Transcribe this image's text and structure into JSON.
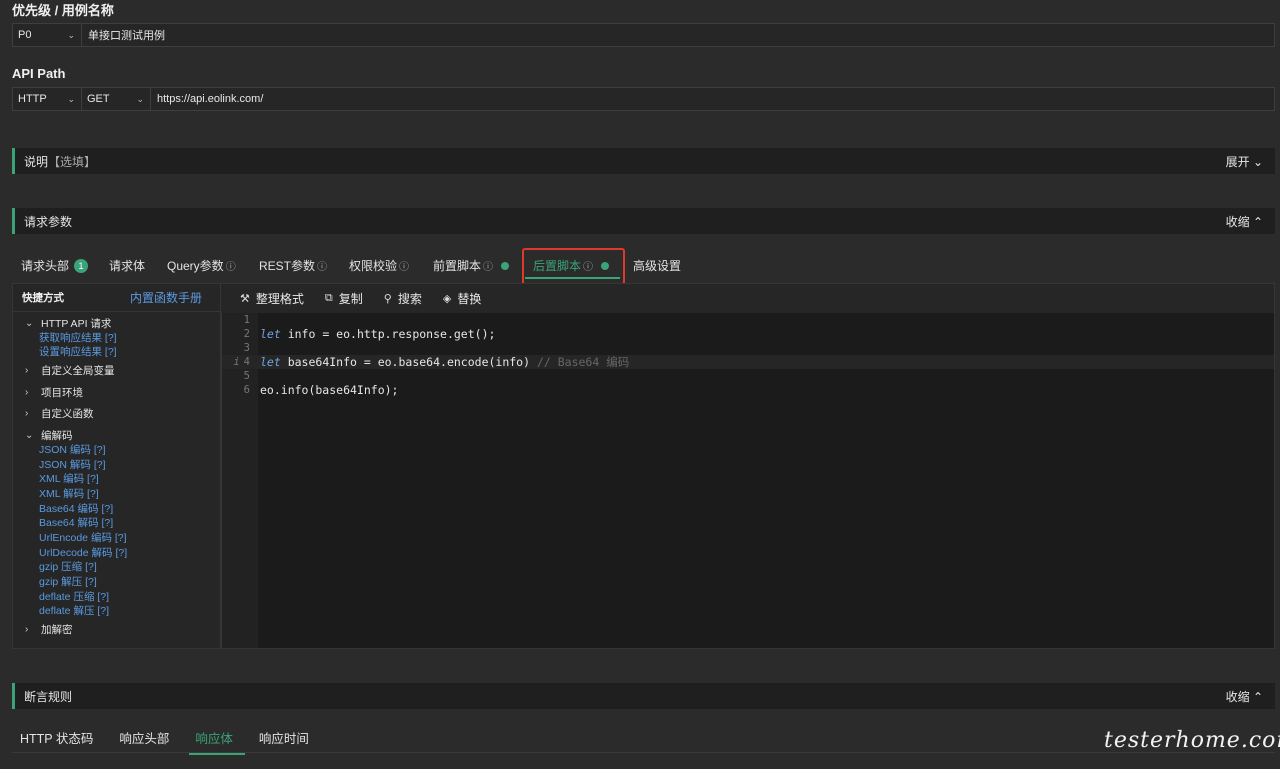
{
  "priority_section": {
    "title": "优先级 / 用例名称",
    "priority": "P0",
    "case_name": "单接口测试用例"
  },
  "api_path_section": {
    "title": "API Path",
    "protocol": "HTTP",
    "method": "GET",
    "url": "https://api.eolink.com/"
  },
  "description_section": {
    "title": "说明",
    "hint": "【选填】",
    "toggle": "展开 ⌄"
  },
  "request_params_section": {
    "title": "请求参数",
    "toggle": "收缩 ⌃"
  },
  "request_tabs": [
    {
      "label": "请求头部",
      "badge": "1"
    },
    {
      "label": "请求体"
    },
    {
      "label": "Query参数",
      "info": "ⓘ"
    },
    {
      "label": "REST参数",
      "info": "ⓘ"
    },
    {
      "label": "权限校验",
      "info": "ⓘ"
    },
    {
      "label": "前置脚本",
      "info": "ⓘ"
    },
    {
      "label": "后置脚本",
      "info": "ⓘ",
      "active": true
    },
    {
      "label": "高级设置"
    }
  ],
  "sidebar": {
    "title": "快捷方式",
    "manual_link": "内置函数手册",
    "groups": {
      "http": "HTTP API 请求",
      "http_items": [
        "获取响应结果 [?]",
        "设置响应结果 [?]"
      ],
      "global_vars": "自定义全局变量",
      "env": "项目环境",
      "funcs": "自定义函数",
      "codec": "编解码",
      "codec_items": [
        "JSON 编码 [?]",
        "JSON 解码 [?]",
        "XML 编码 [?]",
        "XML 解码 [?]",
        "Base64 编码 [?]",
        "Base64 解码 [?]",
        "UrlEncode 编码 [?]",
        "UrlDecode 解码 [?]",
        "gzip 压缩 [?]",
        "gzip 解压 [?]",
        "deflate 压缩 [?]",
        "deflate 解压 [?]"
      ],
      "crypto": "加解密"
    }
  },
  "editor_toolbar": {
    "format": "整理格式",
    "copy": "复制",
    "search": "搜索",
    "replace": "替换"
  },
  "code_lines": {
    "n1": "1",
    "n2": "2",
    "n3": "3",
    "n4": "4",
    "n5": "5",
    "n6": "6",
    "l2_kw": "let",
    "l2_rest": " info = eo.http.response.get();",
    "l4_marker": "i",
    "l4_kw": "let",
    "l4_rest": " base64Info = eo.base64.encode(info) ",
    "l4_comment": "// Base64 编码",
    "l6": "eo.info(base64Info);"
  },
  "assert_section": {
    "title": "断言规则",
    "toggle": "收缩 ⌃"
  },
  "assert_tabs": [
    "HTTP 状态码",
    "响应头部",
    "响应体",
    "响应时间"
  ],
  "watermark": "testerhome.com",
  "colors": {
    "accent": "#3aa377",
    "link": "#5b9ae0",
    "highlight_box": "#e0382b"
  }
}
